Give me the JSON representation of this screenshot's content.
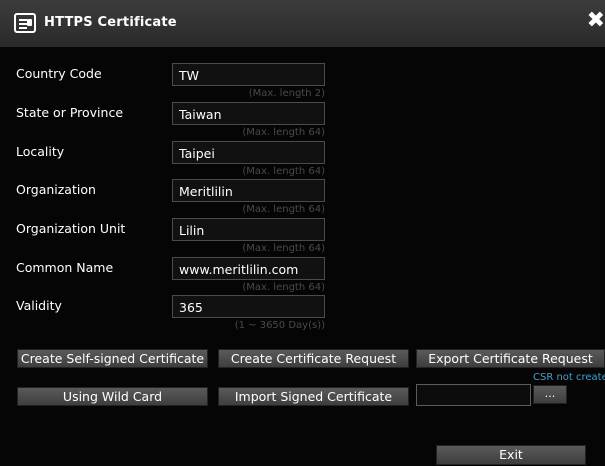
{
  "window": {
    "title": "HTTPS Certificate"
  },
  "form": {
    "fields": [
      {
        "label": "Country Code",
        "value": "TW",
        "hint": "(Max. length 2)"
      },
      {
        "label": "State or Province",
        "value": "Taiwan",
        "hint": "(Max. length 64)"
      },
      {
        "label": "Locality",
        "value": "Taipei",
        "hint": "(Max. length 64)"
      },
      {
        "label": "Organization",
        "value": "Meritlilin",
        "hint": "(Max. length 64)"
      },
      {
        "label": "Organization Unit",
        "value": "Lilin",
        "hint": "(Max. length 64)"
      },
      {
        "label": "Common Name",
        "value": "www.meritlilin.com",
        "hint": "(Max. length 64)"
      },
      {
        "label": "Validity",
        "value": "365",
        "hint": "(1 ~ 3650 Day(s))"
      }
    ]
  },
  "actions": {
    "create_self_signed": "Create Self-signed Certificate",
    "create_request": "Create Certificate Request",
    "export_request": "Export Certificate Request",
    "csr_status": "CSR not created",
    "using_wild_card": "Using Wild Card",
    "import_signed": "Import Signed Certificate",
    "browse": "...",
    "exit": "Exit"
  },
  "icons": {
    "title": "certificate-icon",
    "close": "close-icon"
  },
  "colors": {
    "status_text": "#3aa3d8",
    "background": "#050505",
    "titlebar": "#333333"
  }
}
